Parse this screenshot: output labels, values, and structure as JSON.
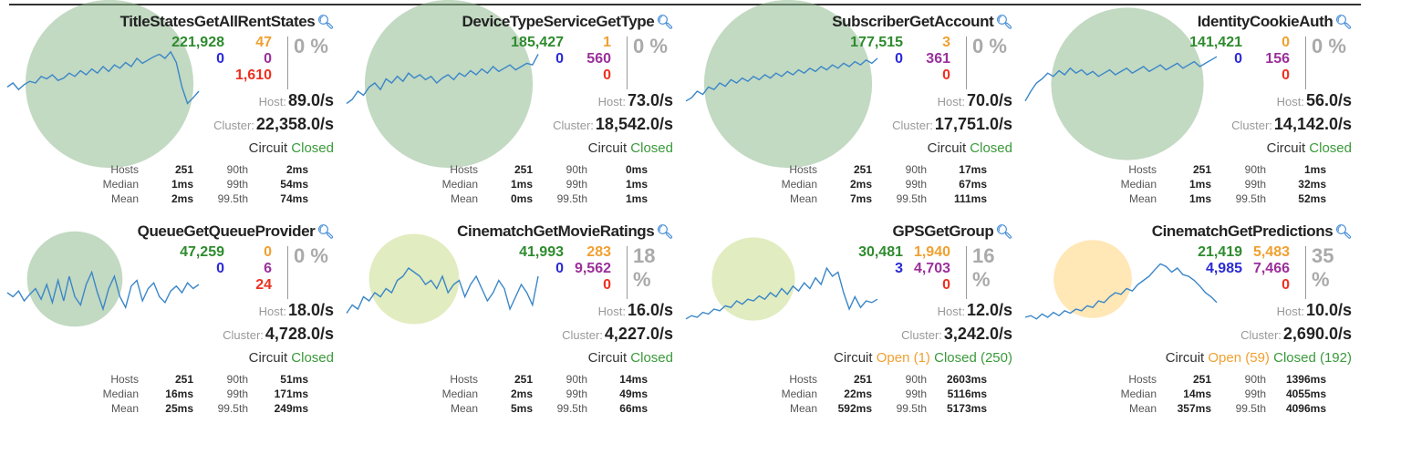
{
  "colors": {
    "circle_healthy": "#8fb990",
    "circle_warning": "#c8dc8c",
    "circle_degraded": "#ffd37a",
    "sparkline": "#3a86c8"
  },
  "labels": {
    "host": "Host:",
    "cluster": "Cluster:",
    "circuit": "Circuit",
    "hosts": "Hosts",
    "median": "Median",
    "mean": "Mean",
    "p90": "90th",
    "p99": "99th",
    "p995": "99.5th"
  },
  "cards": [
    {
      "title": "TitleStatesGetAllRentStates",
      "success": "221,928",
      "short_circuit": "0",
      "timeout": "47",
      "rejected": "0",
      "failure": "1,610",
      "error_pct": "0 %",
      "host_rate": "89.0/s",
      "cluster_rate": "22,358.0/s",
      "circuit_open": "",
      "circuit_closed": "Closed",
      "hosts": "251",
      "median": "1ms",
      "mean": "2ms",
      "p90": "2ms",
      "p99": "54ms",
      "p995": "74ms",
      "health": "healthy",
      "circle_size": 0.97,
      "sparkline": [
        0.55,
        0.5,
        0.58,
        0.52,
        0.48,
        0.5,
        0.42,
        0.45,
        0.4,
        0.47,
        0.44,
        0.38,
        0.42,
        0.35,
        0.4,
        0.33,
        0.38,
        0.3,
        0.36,
        0.28,
        0.32,
        0.25,
        0.3,
        0.2,
        0.26,
        0.22,
        0.18,
        0.15,
        0.2,
        0.12,
        0.25,
        0.55,
        0.75,
        0.68,
        0.6
      ]
    },
    {
      "title": "DeviceTypeServiceGetType",
      "success": "185,427",
      "short_circuit": "0",
      "timeout": "1",
      "rejected": "560",
      "failure": "0",
      "error_pct": "0 %",
      "host_rate": "73.0/s",
      "cluster_rate": "18,542.0/s",
      "circuit_open": "",
      "circuit_closed": "Closed",
      "hosts": "251",
      "median": "1ms",
      "mean": "0ms",
      "p90": "0ms",
      "p99": "1ms",
      "p995": "1ms",
      "health": "healthy",
      "circle_size": 0.97,
      "sparkline": [
        0.75,
        0.7,
        0.6,
        0.65,
        0.55,
        0.5,
        0.58,
        0.45,
        0.5,
        0.42,
        0.48,
        0.38,
        0.44,
        0.4,
        0.46,
        0.42,
        0.5,
        0.44,
        0.4,
        0.46,
        0.38,
        0.42,
        0.35,
        0.4,
        0.33,
        0.38,
        0.3,
        0.36,
        0.32,
        0.28,
        0.34,
        0.3,
        0.26,
        0.28,
        0.15
      ]
    },
    {
      "title": "SubscriberGetAccount",
      "success": "177,515",
      "short_circuit": "0",
      "timeout": "3",
      "rejected": "361",
      "failure": "0",
      "error_pct": "0 %",
      "host_rate": "70.0/s",
      "cluster_rate": "17,751.0/s",
      "circuit_open": "",
      "circuit_closed": "Closed",
      "hosts": "251",
      "median": "2ms",
      "mean": "7ms",
      "p90": "17ms",
      "p99": "67ms",
      "p995": "111ms",
      "health": "healthy",
      "circle_size": 0.97,
      "sparkline": [
        0.72,
        0.68,
        0.6,
        0.64,
        0.55,
        0.58,
        0.5,
        0.54,
        0.46,
        0.5,
        0.44,
        0.48,
        0.42,
        0.46,
        0.4,
        0.44,
        0.38,
        0.42,
        0.36,
        0.4,
        0.34,
        0.38,
        0.32,
        0.36,
        0.3,
        0.34,
        0.28,
        0.32,
        0.26,
        0.3,
        0.24,
        0.28,
        0.22,
        0.26,
        0.2
      ]
    },
    {
      "title": "IdentityCookieAuth",
      "success": "141,421",
      "short_circuit": "0",
      "timeout": "0",
      "rejected": "156",
      "failure": "0",
      "error_pct": "0 %",
      "host_rate": "56.0/s",
      "cluster_rate": "14,142.0/s",
      "circuit_open": "",
      "circuit_closed": "Closed",
      "hosts": "251",
      "median": "1ms",
      "mean": "1ms",
      "p90": "1ms",
      "p99": "32ms",
      "p995": "52ms",
      "health": "healthy",
      "circle_size": 0.88,
      "sparkline": [
        0.72,
        0.6,
        0.5,
        0.45,
        0.38,
        0.42,
        0.35,
        0.4,
        0.32,
        0.38,
        0.34,
        0.4,
        0.36,
        0.42,
        0.38,
        0.34,
        0.4,
        0.36,
        0.32,
        0.38,
        0.34,
        0.3,
        0.36,
        0.32,
        0.28,
        0.34,
        0.3,
        0.26,
        0.32,
        0.28,
        0.24,
        0.3,
        0.26,
        0.22,
        0.18
      ]
    },
    {
      "title": "QueueGetQueueProvider",
      "success": "47,259",
      "short_circuit": "0",
      "timeout": "0",
      "rejected": "6",
      "failure": "24",
      "error_pct": "0 %",
      "host_rate": "18.0/s",
      "cluster_rate": "4,728.0/s",
      "circuit_open": "",
      "circuit_closed": "Closed",
      "hosts": "251",
      "median": "16ms",
      "mean": "25ms",
      "p90": "51ms",
      "p99": "171ms",
      "p995": "249ms",
      "health": "healthy",
      "circle_size": 0.55,
      "sparkline": [
        0.5,
        0.55,
        0.48,
        0.6,
        0.52,
        0.45,
        0.58,
        0.4,
        0.62,
        0.35,
        0.6,
        0.3,
        0.55,
        0.65,
        0.4,
        0.25,
        0.5,
        0.7,
        0.45,
        0.3,
        0.55,
        0.68,
        0.42,
        0.35,
        0.6,
        0.45,
        0.38,
        0.55,
        0.62,
        0.48,
        0.42,
        0.5,
        0.38,
        0.45,
        0.4
      ]
    },
    {
      "title": "CinematchGetMovieRatings",
      "success": "41,993",
      "short_circuit": "0",
      "timeout": "283",
      "rejected": "9,562",
      "failure": "0",
      "error_pct": "18 %",
      "host_rate": "16.0/s",
      "cluster_rate": "4,227.0/s",
      "circuit_open": "",
      "circuit_closed": "Closed",
      "hosts": "251",
      "median": "2ms",
      "mean": "5ms",
      "p90": "14ms",
      "p99": "49ms",
      "p995": "66ms",
      "health": "warning",
      "circle_size": 0.52,
      "sparkline": [
        0.75,
        0.65,
        0.7,
        0.55,
        0.6,
        0.5,
        0.55,
        0.45,
        0.5,
        0.35,
        0.3,
        0.2,
        0.25,
        0.3,
        0.4,
        0.35,
        0.45,
        0.3,
        0.5,
        0.4,
        0.35,
        0.55,
        0.4,
        0.3,
        0.45,
        0.6,
        0.5,
        0.35,
        0.45,
        0.7,
        0.55,
        0.4,
        0.5,
        0.65,
        0.3
      ]
    },
    {
      "title": "GPSGetGroup",
      "success": "30,481",
      "short_circuit": "3",
      "timeout": "1,940",
      "rejected": "4,703",
      "failure": "0",
      "error_pct": "16 %",
      "host_rate": "12.0/s",
      "cluster_rate": "3,242.0/s",
      "circuit_open": "Open (1)",
      "circuit_closed": "Closed (250)",
      "hosts": "251",
      "median": "22ms",
      "mean": "592ms",
      "p90": "2603ms",
      "p99": "5116ms",
      "p995": "5173ms",
      "health": "warning",
      "circle_size": 0.48,
      "sparkline": [
        0.82,
        0.78,
        0.8,
        0.74,
        0.76,
        0.7,
        0.72,
        0.66,
        0.68,
        0.6,
        0.64,
        0.58,
        0.6,
        0.54,
        0.58,
        0.5,
        0.55,
        0.45,
        0.52,
        0.42,
        0.48,
        0.38,
        0.45,
        0.32,
        0.4,
        0.2,
        0.3,
        0.25,
        0.5,
        0.7,
        0.55,
        0.68,
        0.6,
        0.62,
        0.58
      ]
    },
    {
      "title": "CinematchGetPredictions",
      "success": "21,419",
      "short_circuit": "4,985",
      "timeout": "5,483",
      "rejected": "7,466",
      "failure": "0",
      "error_pct": "35 %",
      "host_rate": "10.0/s",
      "cluster_rate": "2,690.0/s",
      "circuit_open": "Open (59)",
      "circuit_closed": "Closed (192)",
      "hosts": "251",
      "median": "14ms",
      "mean": "357ms",
      "p90": "1396ms",
      "p99": "4055ms",
      "p995": "4096ms",
      "health": "degraded",
      "circle_size": 0.45,
      "sparkline": [
        0.8,
        0.78,
        0.82,
        0.76,
        0.8,
        0.74,
        0.78,
        0.72,
        0.75,
        0.7,
        0.72,
        0.66,
        0.68,
        0.6,
        0.62,
        0.55,
        0.5,
        0.52,
        0.45,
        0.48,
        0.4,
        0.35,
        0.3,
        0.22,
        0.15,
        0.18,
        0.25,
        0.2,
        0.28,
        0.3,
        0.35,
        0.42,
        0.5,
        0.55,
        0.62
      ]
    }
  ]
}
